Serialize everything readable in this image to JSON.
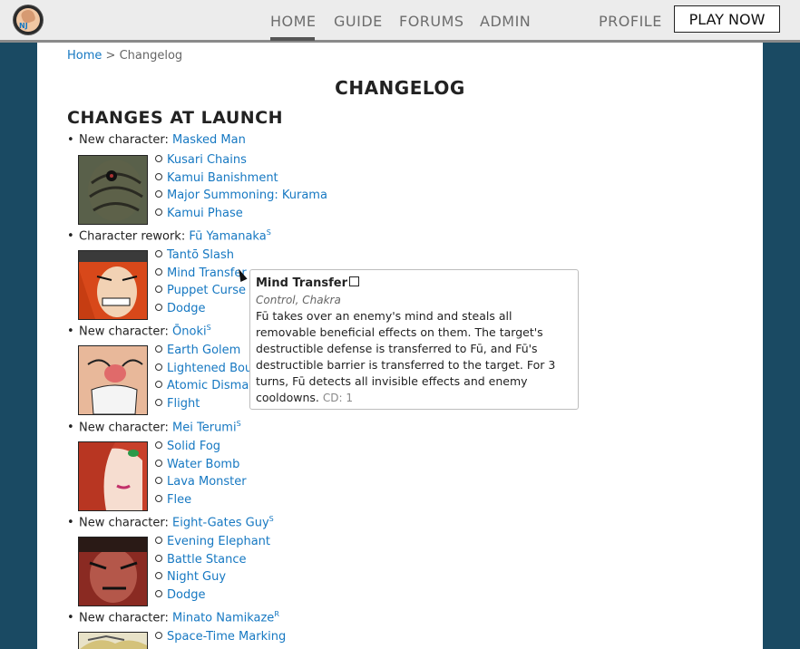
{
  "nav": {
    "home": "HOME",
    "guide": "GUIDE",
    "forums": "FORUMS",
    "admin": "ADMIN",
    "profile": "PROFILE",
    "play": "PLAY NOW",
    "logo_text": "NJ"
  },
  "breadcrumb": {
    "home": "Home",
    "sep": " > ",
    "current": "Changelog"
  },
  "page_title": "CHANGELOG",
  "section_title": "CHANGES AT LAUNCH",
  "entries": [
    {
      "prefix": "New character: ",
      "name": "Masked Man",
      "sup": "",
      "skills": [
        "Kusari Chains",
        "Kamui Banishment",
        "Major Summoning: Kurama",
        "Kamui Phase"
      ]
    },
    {
      "prefix": "Character rework: ",
      "name": "Fū Yamanaka",
      "sup": "S",
      "skills": [
        "Tantō Slash",
        "Mind Transfer",
        "Puppet Curse",
        "Dodge"
      ]
    },
    {
      "prefix": "New character: ",
      "name": "Ōnoki",
      "sup": "S",
      "skills": [
        "Earth Golem",
        "Lightened Bou",
        "Atomic Disma",
        "Flight"
      ]
    },
    {
      "prefix": "New character: ",
      "name": "Mei Terumi",
      "sup": "S",
      "skills": [
        "Solid Fog",
        "Water Bomb",
        "Lava Monster",
        "Flee"
      ]
    },
    {
      "prefix": "New character: ",
      "name": "Eight-Gates Guy",
      "sup": "S",
      "skills": [
        "Evening Elephant",
        "Battle Stance",
        "Night Guy",
        "Dodge"
      ]
    },
    {
      "prefix": "New character: ",
      "name": "Minato Namikaze",
      "sup": "R",
      "skills": [
        "Space-Time Marking"
      ]
    }
  ],
  "tooltip": {
    "title": "Mind Transfer",
    "classes": "Control, Chakra",
    "description": "Fū takes over an enemy's mind and steals all removable beneficial effects on them. The target's destructible defense is transferred to Fū, and Fū's destructible barrier is transferred to the target. For 3 turns, Fū detects all invisible effects and enemy cooldowns.",
    "cooldown": "CD: 1"
  }
}
